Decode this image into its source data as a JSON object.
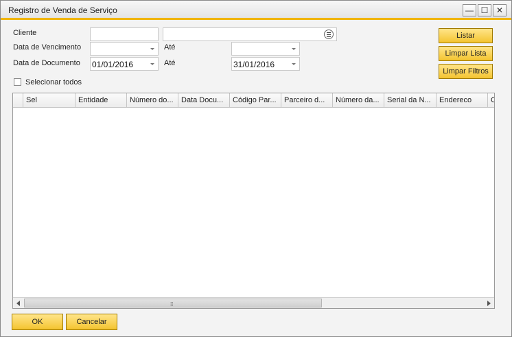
{
  "window": {
    "title": "Registro de Venda de Serviço",
    "minimize_glyph": "—",
    "maximize_glyph": "☐",
    "close_glyph": "✕"
  },
  "filters": {
    "cliente_label": "Cliente",
    "cliente_code": "",
    "cliente_name": "",
    "vencimento_label": "Data de Vencimento",
    "vencimento_from": "",
    "vencimento_ate_label": "Até",
    "vencimento_to": "",
    "documento_label": "Data de Documento",
    "documento_from": "01/01/2016",
    "documento_ate_label": "Até",
    "documento_to": "31/01/2016",
    "selecionar_todos_label": "Selecionar todos",
    "selecionar_todos_checked": false
  },
  "side_buttons": {
    "listar": "Listar",
    "limpar_lista": "Limpar Lista",
    "limpar_filtros": "Limpar Filtros"
  },
  "grid": {
    "columns": [
      "",
      "Sel",
      "Entidade",
      "Número do...",
      "Data Docu...",
      "Código Par...",
      "Parceiro d...",
      "Número da...",
      "Serial da N...",
      "Endereco",
      "C"
    ],
    "rows": [],
    "scroll_grip": "⁞⁞⁞"
  },
  "footer": {
    "ok": "OK",
    "cancelar": "Cancelar"
  },
  "colors": {
    "accent_bar": "#f0b400",
    "button_yellow": "#f4c430"
  }
}
